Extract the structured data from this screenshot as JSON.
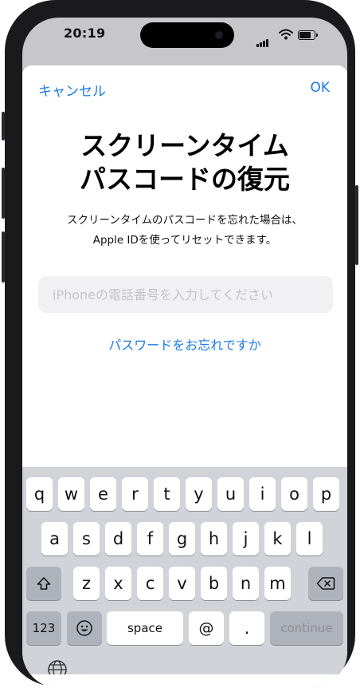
{
  "status": {
    "time": "20:19"
  },
  "nav": {
    "cancel": "キャンセル",
    "ok": "OK"
  },
  "title": {
    "line1": "スクリーンタイム",
    "line2": "パスコードの復元"
  },
  "description": {
    "line1": "スクリーンタイムのパスコードを忘れた場合は、",
    "line2": "Apple IDを使ってリセットできます。"
  },
  "phone_field": {
    "value": "",
    "placeholder": "iPhoneの電話番号を入力してください"
  },
  "forgot_link": "パスワードをお忘れですか",
  "keyboard": {
    "row1": [
      "q",
      "w",
      "e",
      "r",
      "t",
      "y",
      "u",
      "i",
      "o",
      "p"
    ],
    "row2": [
      "a",
      "s",
      "d",
      "f",
      "g",
      "h",
      "j",
      "k",
      "l"
    ],
    "row3": [
      "z",
      "x",
      "c",
      "v",
      "b",
      "n",
      "m"
    ],
    "numbers": "123",
    "space": "space",
    "at": "@",
    "period": ".",
    "continue": "continue"
  },
  "colors": {
    "accent": "#1a7ae6",
    "keyboard_bg": "#d1d3d9",
    "frame": "#1a1a1c"
  },
  "icons": [
    "signal-icon",
    "wifi-icon",
    "battery-icon",
    "shift-icon",
    "backspace-icon",
    "emoji-icon",
    "globe-icon"
  ]
}
